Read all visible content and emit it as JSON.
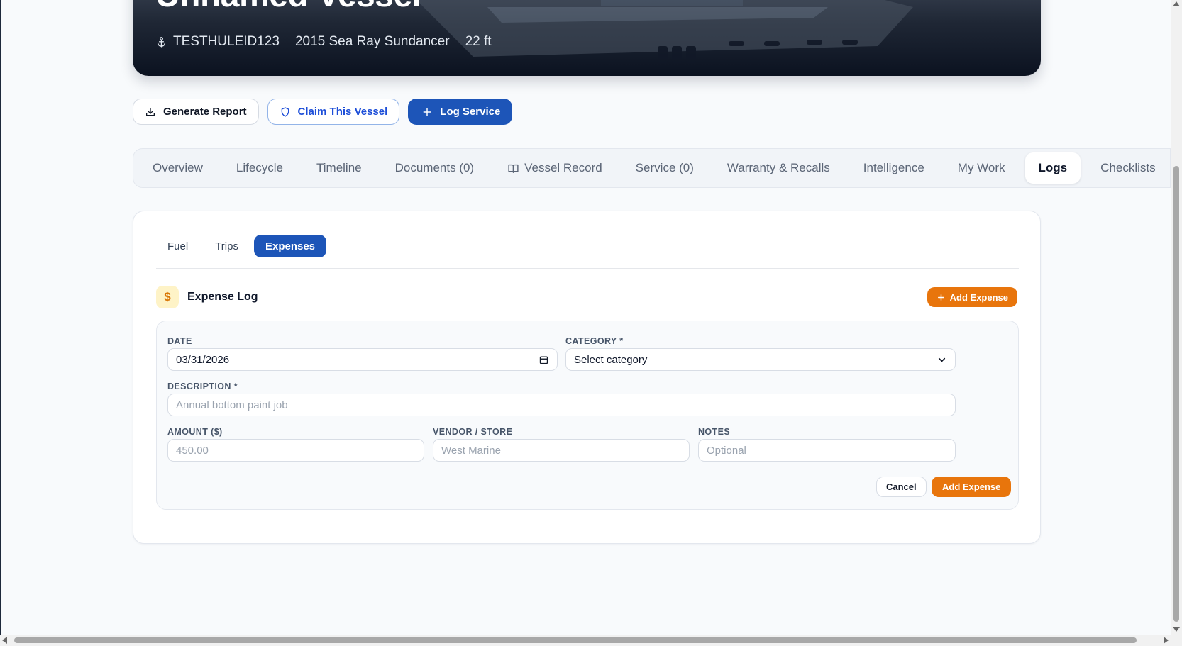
{
  "hero": {
    "title": "Unnamed Vessel",
    "hull_id": "TESTHULEID123",
    "model": "2015 Sea Ray Sundancer",
    "length": "22 ft"
  },
  "actions": {
    "generate_report": "Generate Report",
    "claim_vessel": "Claim This Vessel",
    "log_service": "Log Service"
  },
  "tabs": [
    {
      "label": "Overview"
    },
    {
      "label": "Lifecycle"
    },
    {
      "label": "Timeline"
    },
    {
      "label": "Documents (0)"
    },
    {
      "label": "Vessel Record",
      "icon": "book-icon"
    },
    {
      "label": "Service (0)"
    },
    {
      "label": "Warranty & Recalls"
    },
    {
      "label": "Intelligence"
    },
    {
      "label": "My Work"
    },
    {
      "label": "Logs",
      "active": true
    },
    {
      "label": "Checklists"
    }
  ],
  "subtabs": [
    {
      "label": "Fuel"
    },
    {
      "label": "Trips"
    },
    {
      "label": "Expenses",
      "active": true
    }
  ],
  "expense_log": {
    "icon": "$",
    "title": "Expense Log",
    "add_button": "Add Expense"
  },
  "form": {
    "date_label": "DATE",
    "date_value": "03/31/2026",
    "category_label": "CATEGORY *",
    "category_value": "Select category",
    "description_label": "DESCRIPTION *",
    "description_placeholder": "Annual bottom paint job",
    "amount_label": "AMOUNT ($)",
    "amount_placeholder": "450.00",
    "vendor_label": "VENDOR / STORE",
    "vendor_placeholder": "West Marine",
    "notes_label": "NOTES",
    "notes_placeholder": "Optional",
    "cancel": "Cancel",
    "submit": "Add Expense"
  },
  "colors": {
    "primary": "#1d55b8",
    "accent_orange": "#e8750c",
    "hero_dark": "#0b1220"
  }
}
